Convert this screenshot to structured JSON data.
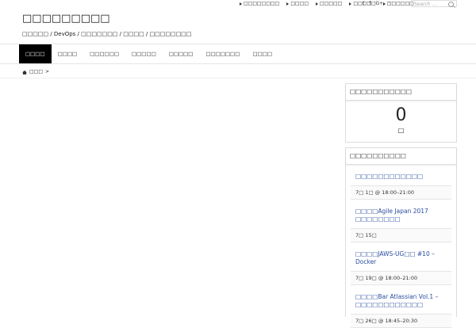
{
  "toplinks": [
    "□□□□□□□□",
    "□□□□",
    "□□□□□",
    "□□□□□",
    "□□□□□□"
  ],
  "social": [
    "twitter-icon",
    "facebook-icon",
    "google-plus-icon",
    "rss-icon"
  ],
  "search": {
    "placeholder": "Search ..."
  },
  "site": {
    "title": "□□□□□□□□□",
    "tagline": "□□□□□ / DevOps / □□□□□□□ / □□□□ / □□□□□□□□"
  },
  "nav": [
    "□□□□",
    "□□□□",
    "□□□□□□",
    "□□□□□",
    "□□□□□",
    "□□□□□□□",
    "□□□□"
  ],
  "breadcrumb": {
    "home": "□□□",
    "sep": ">"
  },
  "widget_counter": {
    "title": "□□□□□□□□□□□",
    "value": "0",
    "unit": "□"
  },
  "widget_events": {
    "title": "□□□□□□□□□□",
    "events": [
      {
        "title": "□□□□□□□□□□□□",
        "time": "7□ 1□ @ 18:00–21:00"
      },
      {
        "title": "□□□□Agile Japan 2017 □□□□□□□□",
        "time": "7□ 15□"
      },
      {
        "title": "□□□□JAWS-UG□□ #10 – Docker",
        "time": "7□ 19□ @ 18:00–21:00"
      },
      {
        "title": "□□□□Bar Atlassian Vol.1 – □□□□□□□□□□□□",
        "time": "7□ 26□ @ 18:45–20:30"
      }
    ]
  }
}
